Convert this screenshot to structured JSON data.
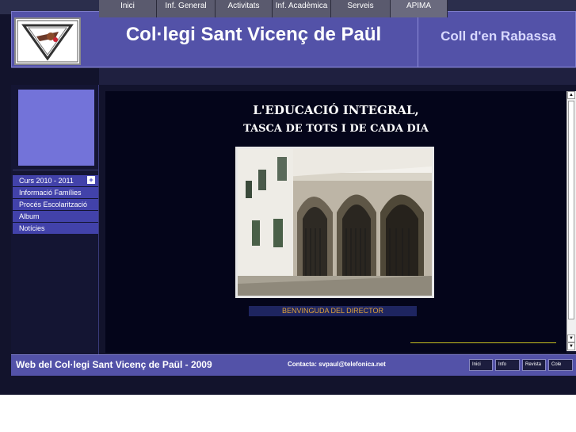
{
  "header": {
    "title": "Col·legi Sant Vicenç de Paül",
    "subtitle": "Coll d'en Rabassa"
  },
  "nav": {
    "items": [
      "Inici",
      "Inf. General",
      "Activitats",
      "Inf. Acadèmica",
      "Serveis",
      "APIMA"
    ]
  },
  "sidebar": {
    "menu": [
      "Curs 2010 - 2011",
      "Informació Famílies",
      "Procés Escolarització",
      "Album",
      "Notícies"
    ],
    "plus_glyph": "+"
  },
  "content": {
    "headline_line1": "L'EDUCACIÓ INTEGRAL,",
    "headline_line2": "TASCA DE TOTS I DE CADA DIA",
    "welcome_label": "BENVINGUDA DEL DIRECTOR"
  },
  "footer": {
    "left_text": "Web del Col·legi Sant Vicenç de Paül - 2009",
    "contact": "Contacta: svpaul@telefonica.net",
    "buttons": [
      "Inici",
      "Info",
      "Revista",
      "Cole"
    ]
  },
  "scrollbar": {
    "up_glyph": "▲",
    "down_glyph": "▼"
  },
  "colors": {
    "header_bg": "#5352a8",
    "page_bg": "#12132c",
    "menu_bg": "#4242aa",
    "welcome_text": "#e0a23a"
  },
  "icons": [
    "school-logo-icon",
    "plus-icon",
    "scroll-up-icon",
    "scroll-down-icon"
  ]
}
